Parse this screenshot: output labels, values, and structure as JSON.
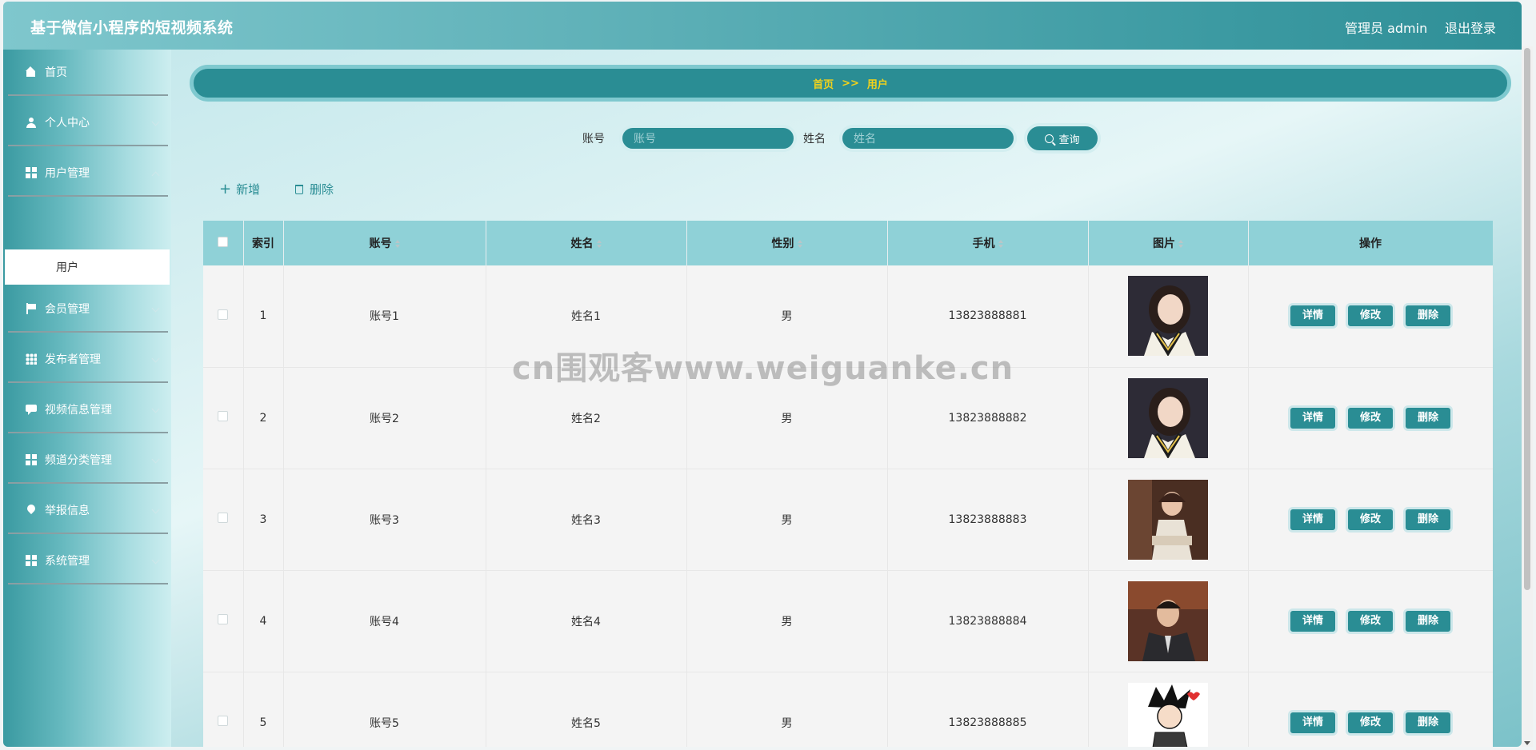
{
  "header": {
    "title": "基于微信小程序的短视频系统",
    "admin_label": "管理员 admin",
    "logout_label": "退出登录"
  },
  "sidebar": {
    "items": [
      {
        "label": "首页",
        "icon": "home-icon"
      },
      {
        "label": "个人中心",
        "icon": "user-icon"
      },
      {
        "label": "用户管理",
        "icon": "grid-icon"
      },
      {
        "label": "会员管理",
        "icon": "flag-icon"
      },
      {
        "label": "发布者管理",
        "icon": "apps-icon"
      },
      {
        "label": "视频信息管理",
        "icon": "chat-icon"
      },
      {
        "label": "频道分类管理",
        "icon": "grid-icon"
      },
      {
        "label": "举报信息",
        "icon": "pin-icon"
      },
      {
        "label": "系统管理",
        "icon": "grid-icon"
      }
    ],
    "active_sub": "用户"
  },
  "breadcrumb": {
    "home": "首页",
    "sep": ">>",
    "current": "用户"
  },
  "search": {
    "account_label": "账号",
    "account_placeholder": "账号",
    "name_label": "姓名",
    "name_placeholder": "姓名",
    "button": "查询"
  },
  "actions": {
    "add": "新增",
    "delete": "删除"
  },
  "table": {
    "columns": [
      "索引",
      "账号",
      "姓名",
      "性别",
      "手机",
      "图片",
      "操作"
    ],
    "rows": [
      {
        "index": "1",
        "account": "账号1",
        "name": "姓名1",
        "gender": "男",
        "phone": "13823888881"
      },
      {
        "index": "2",
        "account": "账号2",
        "name": "姓名2",
        "gender": "男",
        "phone": "13823888882"
      },
      {
        "index": "3",
        "account": "账号3",
        "name": "姓名3",
        "gender": "男",
        "phone": "13823888883"
      },
      {
        "index": "4",
        "account": "账号4",
        "name": "姓名4",
        "gender": "男",
        "phone": "13823888884"
      },
      {
        "index": "5",
        "account": "账号5",
        "name": "姓名5",
        "gender": "男",
        "phone": "13823888885"
      }
    ],
    "ops": {
      "detail": "详情",
      "edit": "修改",
      "remove": "删除"
    }
  },
  "watermark": "cn围观客www.weiguanke.cn",
  "colors": {
    "accent": "#2a8d94",
    "header_bg": "#5fb1b8",
    "breadcrumb_text": "#f2d21b",
    "table_header": "#8fd1d7"
  }
}
